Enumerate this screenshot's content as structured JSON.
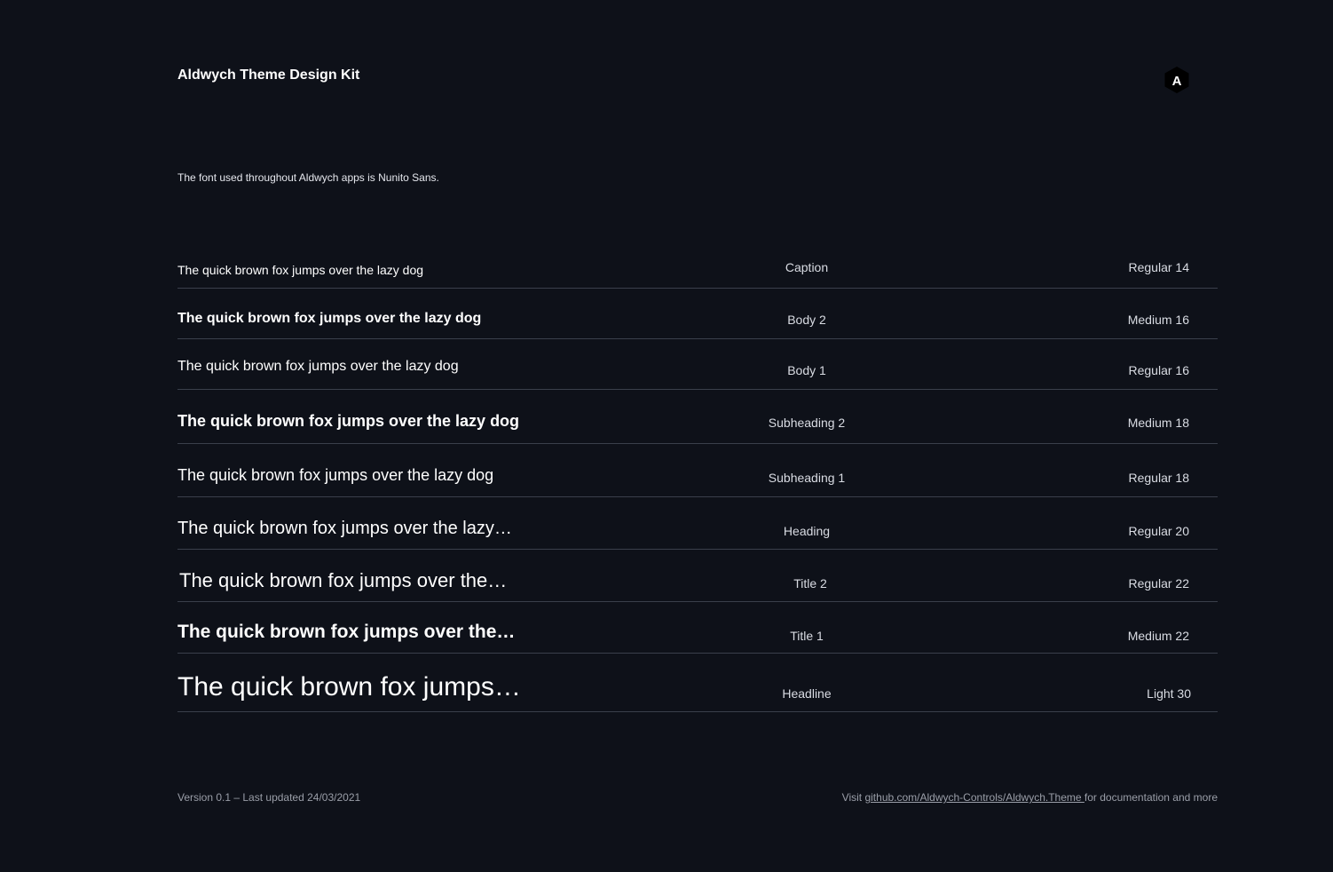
{
  "header": {
    "title": "Aldwych Theme Design Kit",
    "logo_letter": "A",
    "logo_icon": "aldwych-hexagon-logo"
  },
  "intro": "The font used throughout Aldwych apps is Nunito Sans.",
  "type_scale": [
    {
      "sample": "The quick brown fox jumps over the lazy dog",
      "style": "Caption",
      "weight": "Regular 14"
    },
    {
      "sample": "The quick brown fox jumps over the lazy dog",
      "style": "Body 2",
      "weight": "Medium 16"
    },
    {
      "sample": "The quick brown fox jumps over the lazy dog",
      "style": "Body 1",
      "weight": "Regular 16"
    },
    {
      "sample": "The quick brown fox jumps over the lazy dog",
      "style": "Subheading 2",
      "weight": "Medium 18"
    },
    {
      "sample": "The quick brown fox jumps over the lazy dog",
      "style": "Subheading 1",
      "weight": "Regular 18"
    },
    {
      "sample": "The quick brown fox jumps over the lazy…",
      "style": "Heading",
      "weight": "Regular 20"
    },
    {
      "sample": "The quick brown fox jumps over the…",
      "style": "Title 2",
      "weight": "Regular 22"
    },
    {
      "sample": "The quick brown fox jumps over the…",
      "style": "Title 1",
      "weight": "Medium 22"
    },
    {
      "sample": "The quick brown fox jumps…",
      "style": "Headline",
      "weight": "Light 30"
    }
  ],
  "footer": {
    "version": "Version 0.1 – Last updated 24/03/2021",
    "visit_prefix": "Visit ",
    "link_text": "github.com/Aldwych-Controls/Aldwych.Theme ",
    "visit_suffix": "for documentation and more"
  },
  "colors": {
    "background": "#0e1119",
    "text": "#ffffff",
    "muted": "#9a9ea8",
    "divider": "#3a3f4b"
  }
}
